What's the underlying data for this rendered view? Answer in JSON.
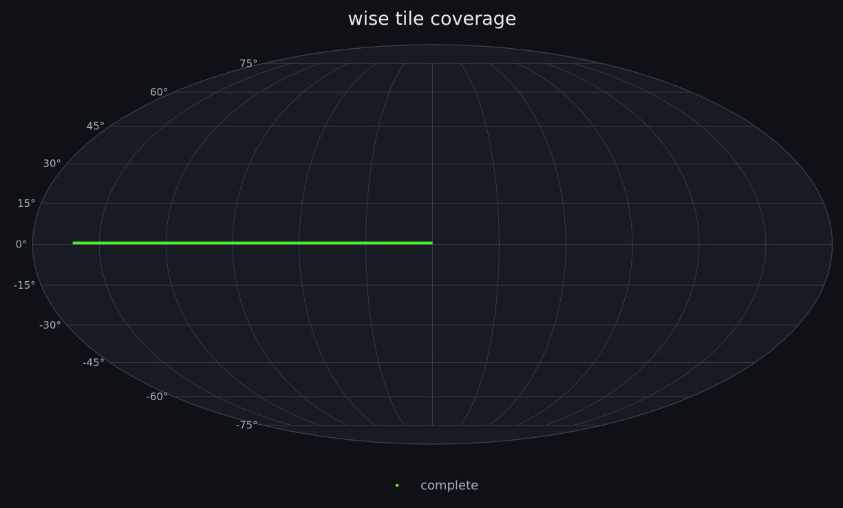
{
  "chart_data": {
    "type": "scatter",
    "projection": "mollweide",
    "title": "wise tile coverage",
    "lat_ticks": [
      75,
      60,
      45,
      30,
      15,
      0,
      -15,
      -30,
      -45,
      -60,
      -75
    ],
    "lat_tick_labels": [
      "75°",
      "60°",
      "45°",
      "30°",
      "15°",
      "0°",
      "-15°",
      "-30°",
      "-45°",
      "-60°",
      "-75°"
    ],
    "lon_gridlines": [
      -150,
      -120,
      -90,
      -60,
      -30,
      0,
      30,
      60,
      90,
      120,
      150
    ],
    "grid": true,
    "legend_placement": "bottom-center",
    "series": [
      {
        "name": "complete",
        "color": "#4cf02a",
        "segment": {
          "lon_start": -162,
          "lon_end": 0,
          "lat": 0.5
        }
      }
    ]
  },
  "colors": {
    "background": "#0f1116",
    "map_fill": "#181b24",
    "grid": "#343a48",
    "outline": "#3c4252"
  }
}
